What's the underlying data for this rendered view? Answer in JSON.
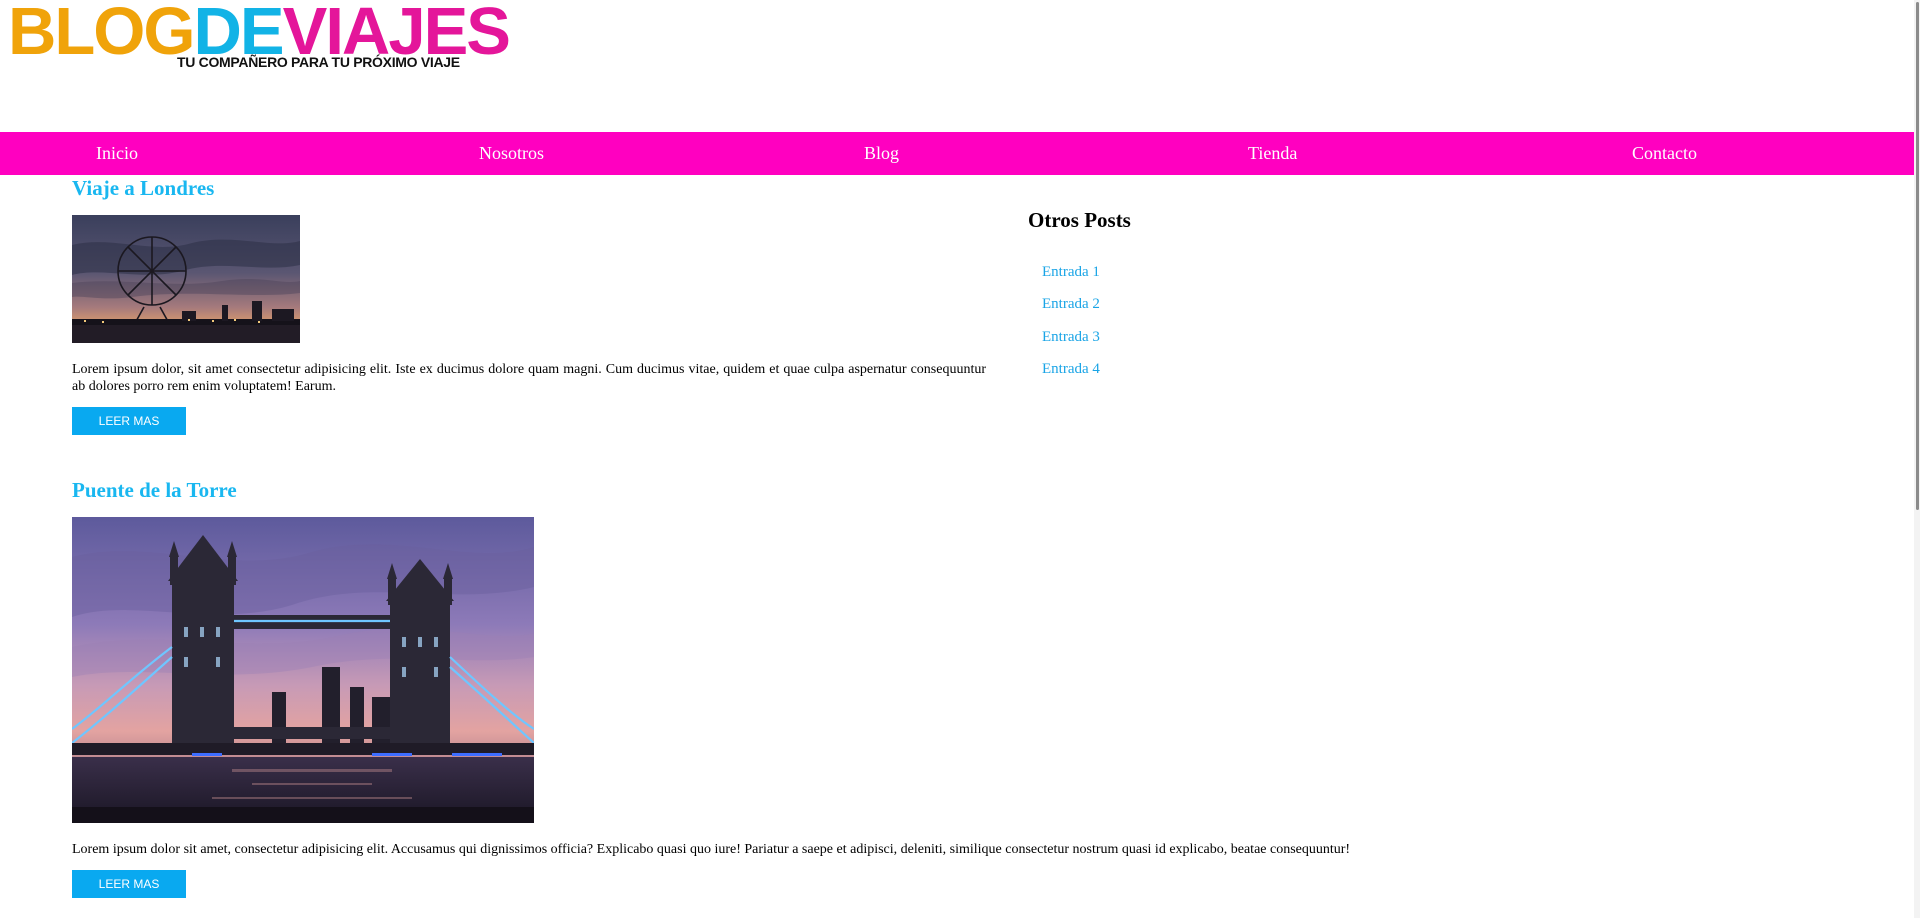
{
  "logo": {
    "part1": "BLOG",
    "part2": "DE",
    "part3": "VIAJES",
    "tagline": "TU COMPAÑERO PARA TU PRÓXIMO VIAJE",
    "colors": {
      "blog": "#f0a30a",
      "de": "#12b3e6",
      "viajes": "#e4169a"
    }
  },
  "nav": {
    "background": "#ff00c0",
    "items": [
      {
        "label": "Inicio"
      },
      {
        "label": "Nosotros"
      },
      {
        "label": "Blog"
      },
      {
        "label": "Tienda"
      },
      {
        "label": "Contacto"
      }
    ]
  },
  "posts": [
    {
      "title": "Viaje a Londres",
      "image": "london-eye-sunset-photo",
      "excerpt": "Lorem ipsum dolor, sit amet consectetur adipisicing elit. Iste ex ducimus dolore quam magni. Cum ducimus vitae, quidem et quae culpa aspernatur consequuntur ab dolores porro rem enim voluptatem! Earum.",
      "button": "LEER MAS"
    },
    {
      "title": "Puente de la Torre",
      "image": "tower-bridge-dusk-photo",
      "excerpt": "Lorem ipsum dolor sit amet, consectetur adipisicing elit. Accusamus qui dignissimos officia? Explicabo quasi quo iure! Pariatur a saepe et adipisci, deleniti, similique consectetur nostrum quasi id explicabo, beatae consequuntur!",
      "button": "LEER MAS"
    }
  ],
  "sidebar": {
    "title": "Otros Posts",
    "items": [
      {
        "label": "Entrada 1"
      },
      {
        "label": "Entrada 2"
      },
      {
        "label": "Entrada 3"
      },
      {
        "label": "Entrada 4"
      }
    ]
  },
  "colors": {
    "accent": "#19b7f0",
    "button": "#09a9f0",
    "link": "#19a4e6"
  }
}
